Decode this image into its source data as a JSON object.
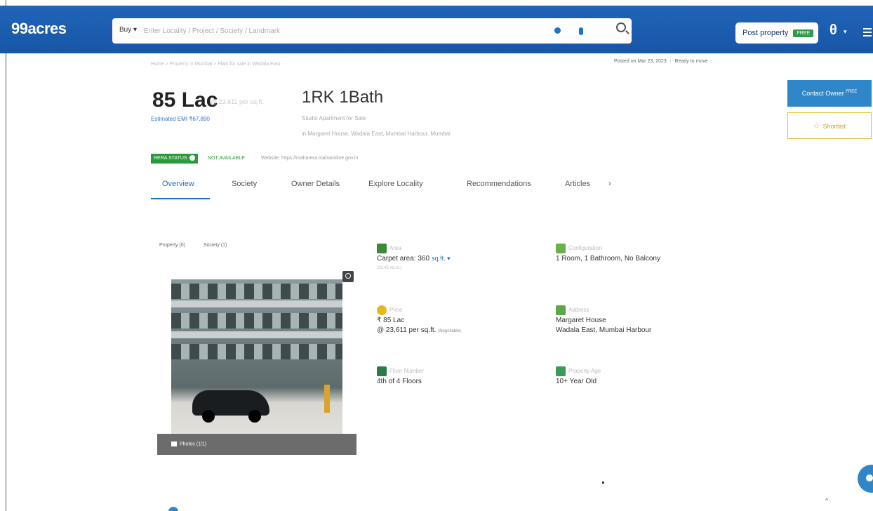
{
  "header": {
    "logo": "99acres",
    "buy_label": "Buy ▾",
    "search_placeholder": "Enter Locality / Project / Society / Landmark",
    "post_property_label": "Post property",
    "free_tag": "FREE",
    "user_icon": "user-icon",
    "menu_icon": "hamburger-icon"
  },
  "subheader": {
    "breadcrumb": "Home > Property in Mumbai > Flats for sale in Wadala East",
    "posted": "Posted on Mar 23, 2023",
    "status": "Ready to move"
  },
  "listing": {
    "price": "85 Lac",
    "price_suffix": "@ 23,611 per sq.ft.",
    "emi": "Estimated EMI ₹67,890",
    "config": "1RK 1Bath",
    "type": "Studio Apartment for Sale",
    "address_line": "in Margaret House, Wadala East, Mumbai Harbour, Mumbai",
    "rera_label": "RERA STATUS",
    "rera_status": "NOT AVAILABLE",
    "rera_website": "Website: https://maharera.mahaonline.gov.in"
  },
  "tabs": [
    {
      "label": "Overview"
    },
    {
      "label": "Society"
    },
    {
      "label": "Owner Details"
    },
    {
      "label": "Explore Locality"
    },
    {
      "label": "Recommendations"
    },
    {
      "label": "Articles"
    }
  ],
  "tab_next": "›",
  "photos": {
    "tab_property": "Property (0)",
    "tab_society": "Society (1)",
    "count_label": "Photos (1/1)"
  },
  "details": {
    "area": {
      "label": "Area",
      "value": "Carpet area: 360",
      "unit": "sq.ft. ▾",
      "sub": "(33.45 sq.m.)"
    },
    "configuration": {
      "label": "Configuration",
      "value": "1 Room, 1 Bathroom, No Balcony"
    },
    "price": {
      "label": "Price",
      "value": "₹ 85 Lac",
      "value2": "@ 23,611 per sq.ft.",
      "note": "(Negotiable)"
    },
    "address": {
      "label": "Address",
      "value": "Margaret House",
      "value2": "Wadala East, Mumbai Harbour"
    },
    "floor": {
      "label": "Floor Number",
      "value": "4th of 4 Floors"
    },
    "age": {
      "label": "Property Age",
      "value": "10+ Year Old"
    }
  },
  "actions": {
    "contact_owner": "Contact Owner",
    "contact_free": "FREE",
    "shortlist": "Shortlist"
  },
  "colors": {
    "brand_blue": "#1a5fb4",
    "accent_blue": "#1a73c8",
    "rera_green": "#2a9a3a",
    "shortlist_gold": "#d9b02c"
  }
}
